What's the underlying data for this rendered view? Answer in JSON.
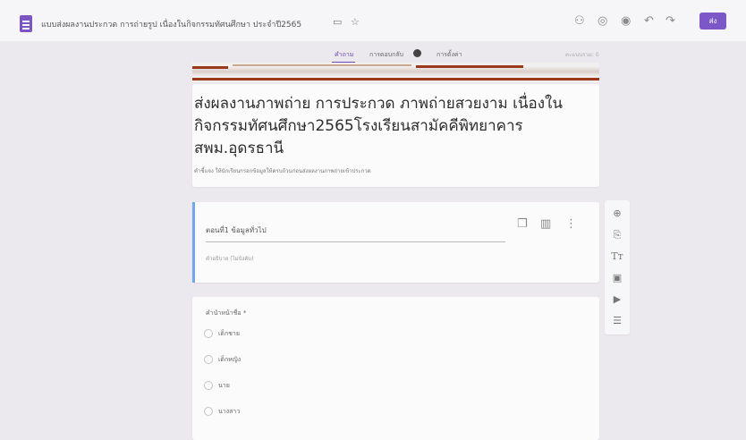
{
  "header": {
    "doc_title": "แบบส่งผลงานประกวด การถ่ายรูป เนื่องในกิจกรรมทัศนศึกษา ประจำปี2565",
    "send_label": "ส่ง",
    "icons": [
      "folder-icon",
      "star-icon",
      "customize-theme-icon",
      "palette-icon",
      "preview-eye-icon",
      "undo-icon",
      "redo-icon"
    ]
  },
  "tabs": {
    "questions": "คำถาม",
    "responses": "การตอบกลับ",
    "settings": "การตั้งค่า",
    "points": "คะแนนรวม: 0"
  },
  "form": {
    "title": "ส่งผลงานภาพถ่าย  การประกวด ภาพถ่ายสวยงาม เนื่องในกิจกรรมทัศนศึกษา2565โรงเรียนสามัคคีพิทยาคาร สพม.อุดรธานี",
    "description": "คำชี้แจง ให้นักเรียนกรอกข้อมูลให้ครบถ้วนก่อนส่งผลงานภาพถ่ายเข้าประกวด"
  },
  "section": {
    "label": "ตอนที่1 ข้อมูลทั่วไป",
    "description": "คำอธิบาย (ไม่บังคับ)"
  },
  "question": {
    "title": "คำนำหน้าชื่อ *",
    "options": [
      "เด็กชาย",
      "เด็กหญิง",
      "นาย",
      "นางสาว"
    ]
  },
  "side_toolbar": [
    "add-question-icon",
    "import-questions-icon",
    "add-title-icon",
    "add-image-icon",
    "add-video-icon",
    "add-section-icon"
  ],
  "colors": {
    "accent": "#7b57c7",
    "section_bar": "#6ea8ee",
    "banner": "#9a3a1a"
  }
}
